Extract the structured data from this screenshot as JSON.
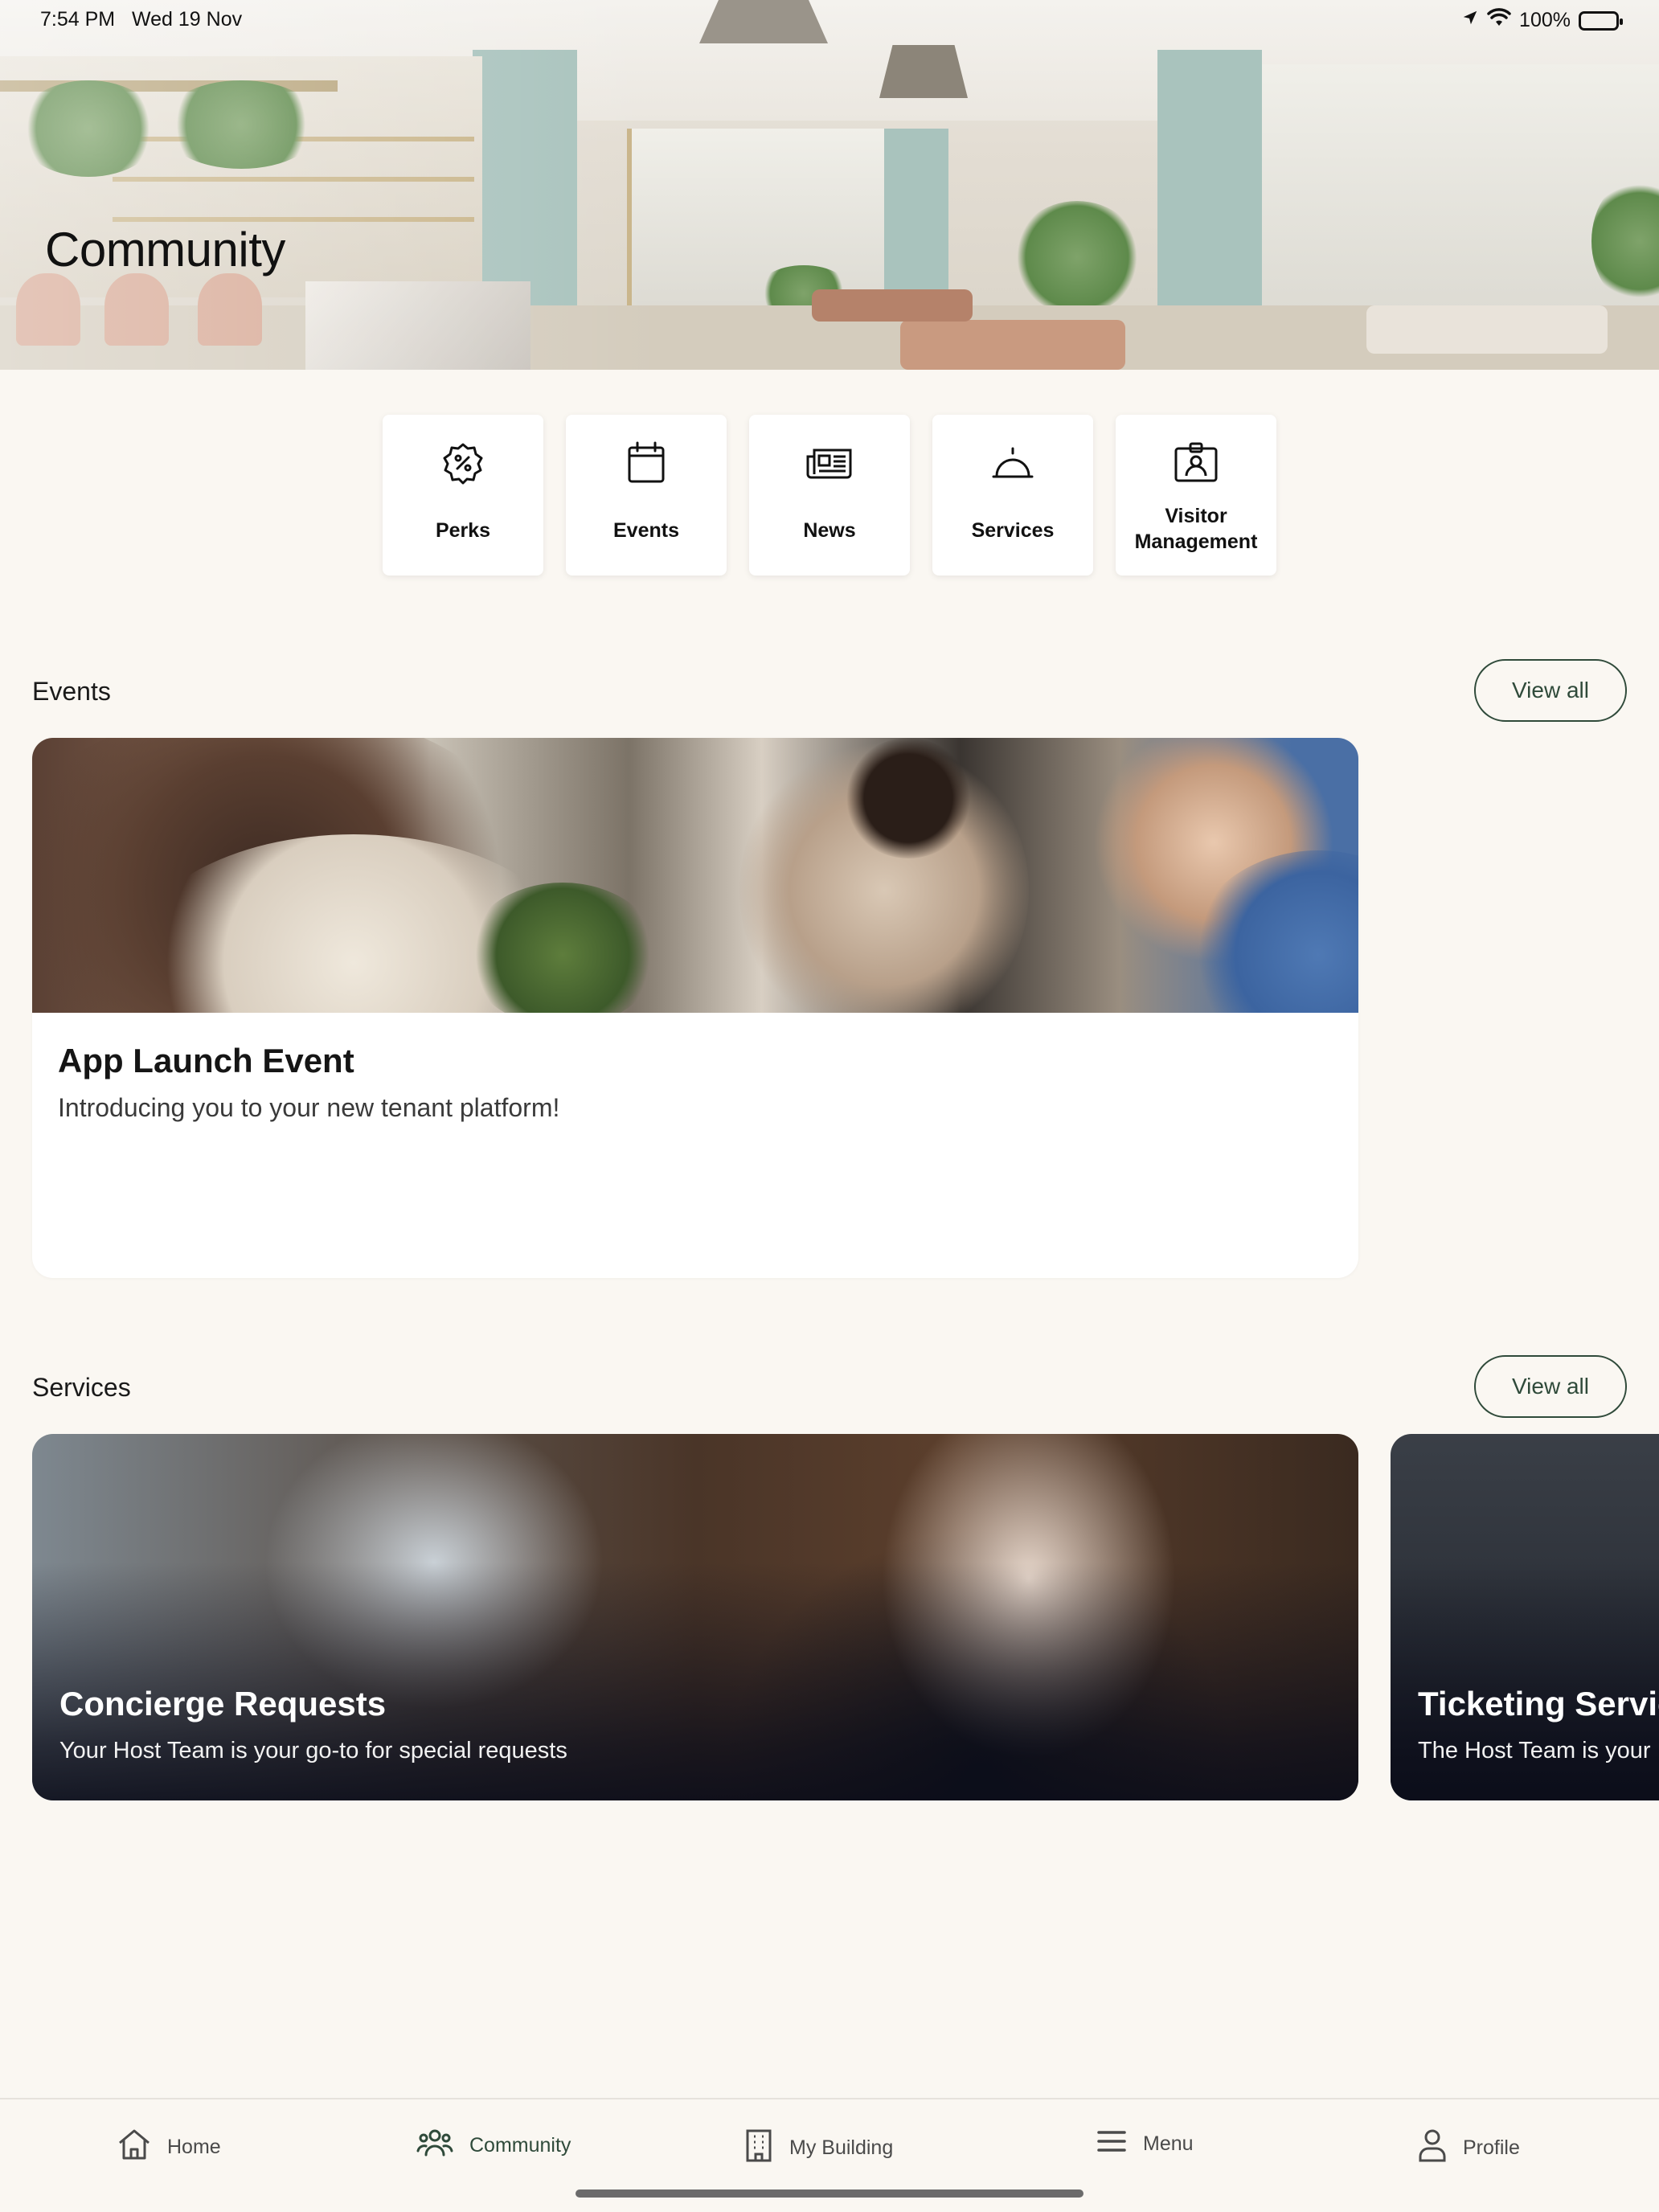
{
  "status_bar": {
    "time": "7:54 PM",
    "date": "Wed 19 Nov",
    "battery": "100%",
    "icons": [
      "location-arrow-icon",
      "wifi-icon",
      "battery-icon"
    ]
  },
  "header": {
    "title": "Community"
  },
  "quick_links": [
    {
      "label": "Perks",
      "icon": "percent-badge-icon"
    },
    {
      "label": "Events",
      "icon": "calendar-icon"
    },
    {
      "label": "News",
      "icon": "newspaper-icon"
    },
    {
      "label": "Services",
      "icon": "service-bell-icon"
    },
    {
      "label_line1": "Visitor",
      "label_line2": "Management",
      "icon": "id-badge-icon"
    }
  ],
  "events_section": {
    "title": "Events",
    "view_all": "View all",
    "card": {
      "title": "App Launch Event",
      "description": "Introducing you to your new tenant platform!"
    }
  },
  "services_section": {
    "title": "Services",
    "view_all": "View all",
    "cards": [
      {
        "title": "Concierge Requests",
        "description": "Your Host Team is your go-to for special requests"
      },
      {
        "title": "Ticketing Servic",
        "description": "The Host Team is your"
      }
    ]
  },
  "tab_bar": {
    "items": [
      {
        "label": "Home",
        "icon": "home-icon",
        "active": false
      },
      {
        "label": "Community",
        "icon": "people-icon",
        "active": true
      },
      {
        "label": "My Building",
        "icon": "building-icon",
        "active": false
      },
      {
        "label": "Menu",
        "icon": "hamburger-menu-icon",
        "active": false
      },
      {
        "label": "Profile",
        "icon": "person-icon",
        "active": false
      }
    ]
  },
  "colors": {
    "background": "#faf7f2",
    "accent_green": "#2f4a3a",
    "card": "#ffffff"
  }
}
